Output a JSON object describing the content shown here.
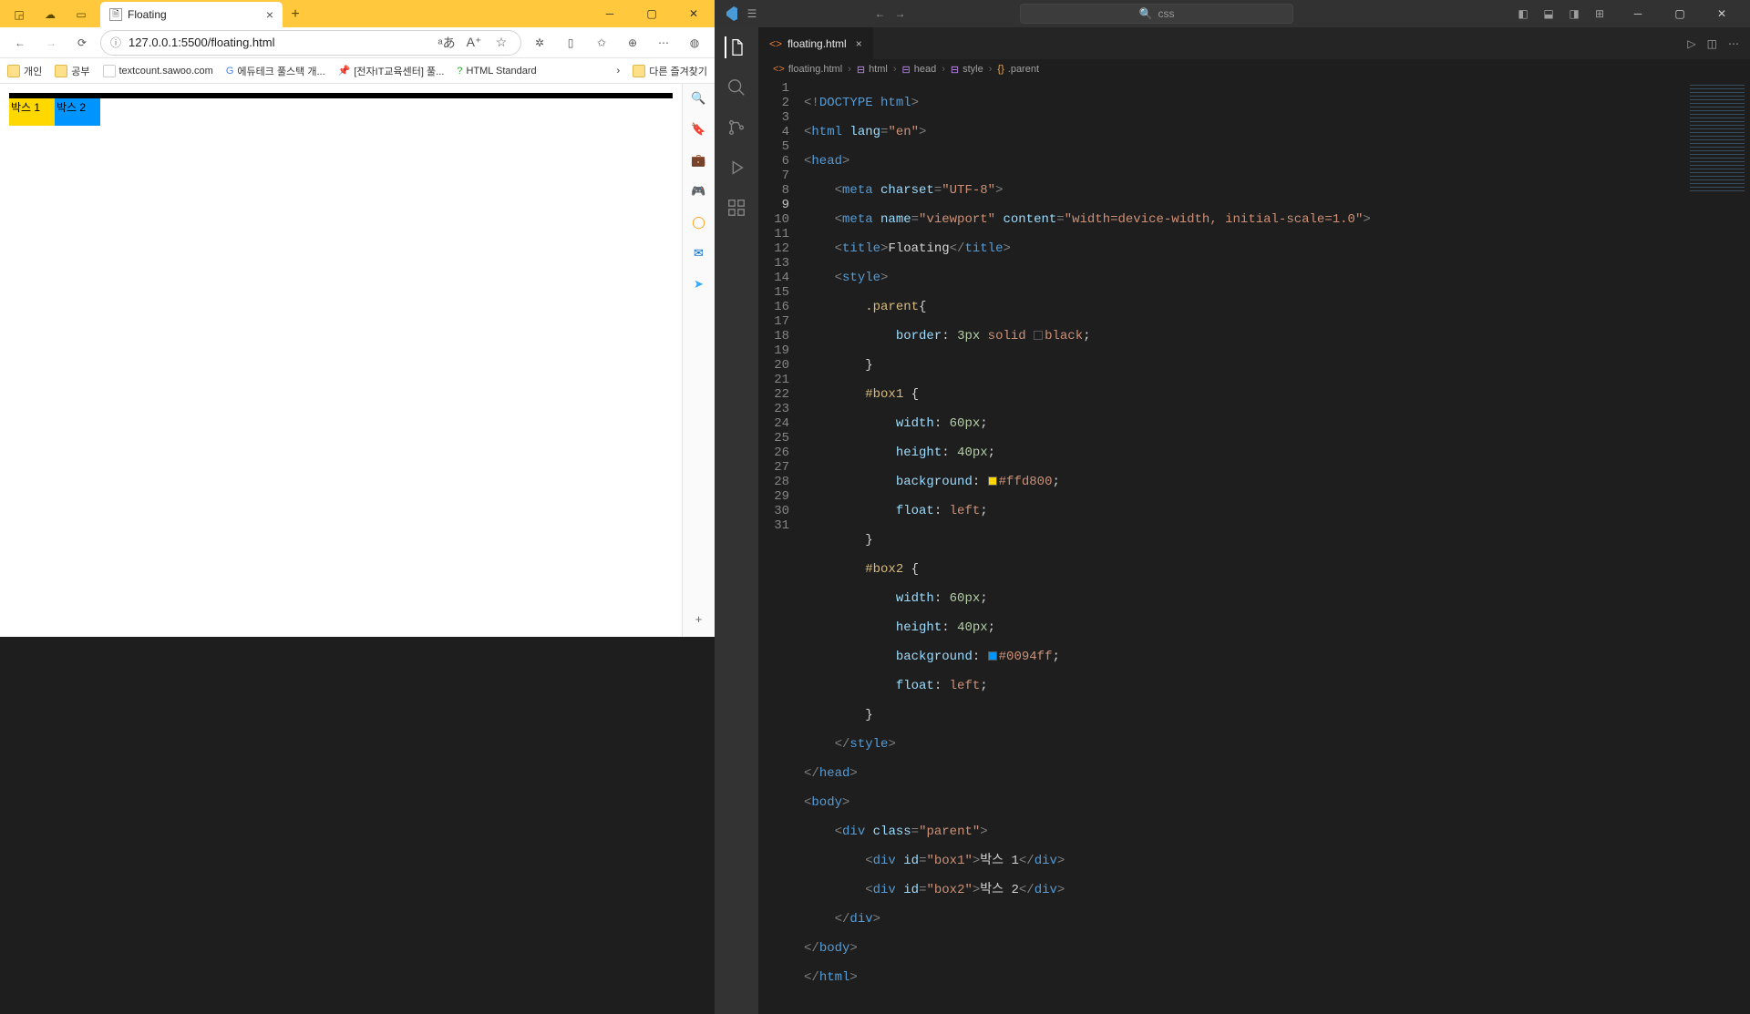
{
  "browser": {
    "tab_title": "Floating",
    "url": "127.0.0.1:5500/floating.html",
    "bookmarks": [
      {
        "label": "개인",
        "kind": "folder"
      },
      {
        "label": "공부",
        "kind": "folder"
      },
      {
        "label": "textcount.sawoo.com",
        "kind": "site"
      },
      {
        "label": "에듀테크 풀스택 개...",
        "kind": "g"
      },
      {
        "label": "[전자IT교육센터] 풀...",
        "kind": "pin"
      },
      {
        "label": "HTML Standard",
        "kind": "q"
      }
    ],
    "bookmarks_overflow": "다른 즐겨찾기",
    "page": {
      "box1": "박스 1",
      "box2": "박스 2"
    }
  },
  "vscode": {
    "search_placeholder": "css",
    "tab": "floating.html",
    "breadcrumb": [
      "floating.html",
      "html",
      "head",
      "style",
      ".parent"
    ],
    "line_numbers": [
      "1",
      "2",
      "3",
      "4",
      "5",
      "6",
      "7",
      "8",
      "9",
      "10",
      "11",
      "12",
      "13",
      "14",
      "15",
      "16",
      "17",
      "18",
      "19",
      "20",
      "21",
      "22",
      "23",
      "24",
      "25",
      "26",
      "27",
      "28",
      "29",
      "30",
      "31"
    ],
    "code": {
      "l1a": "<!",
      "l1b": "DOCTYPE",
      "l1c": " html",
      "l1d": ">",
      "l2a": "<",
      "l2b": "html",
      "l2c": " lang",
      "l2d": "=",
      "l2e": "\"en\"",
      "l2f": ">",
      "l3a": "<",
      "l3b": "head",
      "l3c": ">",
      "l4a": "    <",
      "l4b": "meta",
      "l4c": " charset",
      "l4d": "=",
      "l4e": "\"UTF-8\"",
      "l4f": ">",
      "l5a": "    <",
      "l5b": "meta",
      "l5c": " name",
      "l5d": "=",
      "l5e": "\"viewport\"",
      "l5f": " content",
      "l5g": "=",
      "l5h": "\"width=device-width, initial-scale=1.0\"",
      "l5i": ">",
      "l6a": "    <",
      "l6b": "title",
      "l6c": ">",
      "l6d": "Floating",
      "l6e": "</",
      "l6f": "title",
      "l6g": ">",
      "l7a": "    <",
      "l7b": "style",
      "l7c": ">",
      "l8a": "        ",
      "l8b": ".parent",
      "l8c": "{",
      "l9a": "            ",
      "l9b": "border",
      "l9c": ": ",
      "l9d": "3px",
      "l9e": " solid ",
      "l9f": "black",
      "l9g": ";",
      "l10a": "        }",
      "l11a": "        ",
      "l11b": "#box1",
      "l11c": " {",
      "l12a": "            ",
      "l12b": "width",
      "l12c": ": ",
      "l12d": "60px",
      "l12e": ";",
      "l13a": "            ",
      "l13b": "height",
      "l13c": ": ",
      "l13d": "40px",
      "l13e": ";",
      "l14a": "            ",
      "l14b": "background",
      "l14c": ": ",
      "l14d": "#ffd800",
      "l14e": ";",
      "l15a": "            ",
      "l15b": "float",
      "l15c": ": ",
      "l15d": "left",
      "l15e": ";",
      "l16a": "        }",
      "l17a": "        ",
      "l17b": "#box2",
      "l17c": " {",
      "l18a": "            ",
      "l18b": "width",
      "l18c": ": ",
      "l18d": "60px",
      "l18e": ";",
      "l19a": "            ",
      "l19b": "height",
      "l19c": ": ",
      "l19d": "40px",
      "l19e": ";",
      "l20a": "            ",
      "l20b": "background",
      "l20c": ": ",
      "l20d": "#0094ff",
      "l20e": ";",
      "l21a": "            ",
      "l21b": "float",
      "l21c": ": ",
      "l21d": "left",
      "l21e": ";",
      "l22a": "        }",
      "l23a": "    </",
      "l23b": "style",
      "l23c": ">",
      "l24a": "</",
      "l24b": "head",
      "l24c": ">",
      "l25a": "<",
      "l25b": "body",
      "l25c": ">",
      "l26a": "    <",
      "l26b": "div",
      "l26c": " class",
      "l26d": "=",
      "l26e": "\"parent\"",
      "l26f": ">",
      "l27a": "        <",
      "l27b": "div",
      "l27c": " id",
      "l27d": "=",
      "l27e": "\"box1\"",
      "l27f": ">",
      "l27g": "박스 1",
      "l27h": "</",
      "l27i": "div",
      "l27j": ">",
      "l28a": "        <",
      "l28b": "div",
      "l28c": " id",
      "l28d": "=",
      "l28e": "\"box2\"",
      "l28f": ">",
      "l28g": "박스 2",
      "l28h": "</",
      "l28i": "div",
      "l28j": ">",
      "l29a": "    </",
      "l29b": "div",
      "l29c": ">",
      "l30a": "</",
      "l30b": "body",
      "l30c": ">",
      "l31a": "</",
      "l31b": "html",
      "l31c": ">"
    }
  }
}
